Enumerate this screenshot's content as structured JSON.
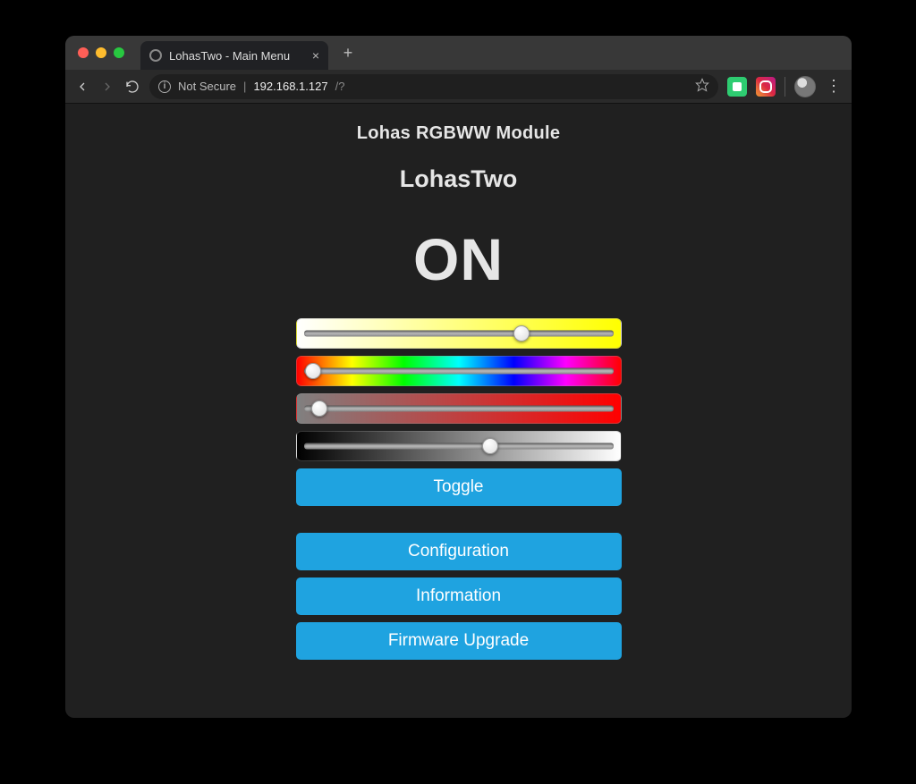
{
  "browser": {
    "tab_title": "LohasTwo - Main Menu",
    "not_secure_label": "Not Secure",
    "host": "192.168.1.127",
    "path": "/?"
  },
  "page": {
    "module_title": "Lohas RGBWW Module",
    "device_name": "LohasTwo",
    "power_state": "ON"
  },
  "sliders": {
    "brightness": {
      "value": 70
    },
    "hue": {
      "value": 3
    },
    "saturation": {
      "value": 5
    },
    "lightness": {
      "value": 60
    }
  },
  "buttons": {
    "toggle": "Toggle",
    "configuration": "Configuration",
    "information": "Information",
    "firmware_upgrade": "Firmware Upgrade"
  }
}
